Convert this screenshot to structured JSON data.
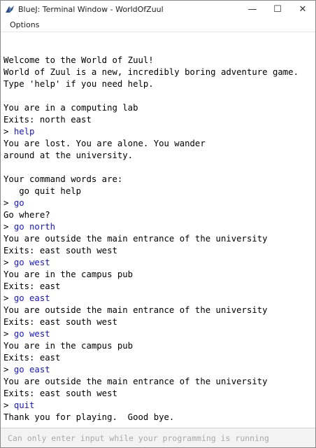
{
  "window": {
    "title": "BlueJ: Terminal Window - WorldOfZuul",
    "controls": {
      "minimize": "—",
      "maximize": "☐",
      "close": "✕"
    }
  },
  "menu": {
    "options_label": "Options"
  },
  "terminal": {
    "prompt": "> ",
    "lines": [
      {
        "text": ""
      },
      {
        "text": "Welcome to the World of Zuul!"
      },
      {
        "text": "World of Zuul is a new, incredibly boring adventure game."
      },
      {
        "text": "Type 'help' if you need help."
      },
      {
        "text": ""
      },
      {
        "text": "You are in a computing lab"
      },
      {
        "text": "Exits: north east"
      },
      {
        "text": "help",
        "cmd": true
      },
      {
        "text": "You are lost. You are alone. You wander"
      },
      {
        "text": "around at the university."
      },
      {
        "text": ""
      },
      {
        "text": "Your command words are:"
      },
      {
        "text": "   go quit help"
      },
      {
        "text": "go",
        "cmd": true
      },
      {
        "text": "Go where?"
      },
      {
        "text": "go north",
        "cmd": true
      },
      {
        "text": "You are outside the main entrance of the university"
      },
      {
        "text": "Exits: east south west"
      },
      {
        "text": "go west",
        "cmd": true
      },
      {
        "text": "You are in the campus pub"
      },
      {
        "text": "Exits: east"
      },
      {
        "text": "go east",
        "cmd": true
      },
      {
        "text": "You are outside the main entrance of the university"
      },
      {
        "text": "Exits: east south west"
      },
      {
        "text": "go west",
        "cmd": true
      },
      {
        "text": "You are in the campus pub"
      },
      {
        "text": "Exits: east"
      },
      {
        "text": "go east",
        "cmd": true
      },
      {
        "text": "You are outside the main entrance of the university"
      },
      {
        "text": "Exits: east south west"
      },
      {
        "text": "quit",
        "cmd": true
      },
      {
        "text": "Thank you for playing.  Good bye."
      }
    ]
  },
  "input": {
    "placeholder": "Can only enter input while your programming is running",
    "value": ""
  },
  "colors": {
    "command": "#1515d6",
    "text": "#000000",
    "input_bg": "#f3f3f3"
  },
  "icons": {
    "app": "bluej-bird-icon"
  }
}
